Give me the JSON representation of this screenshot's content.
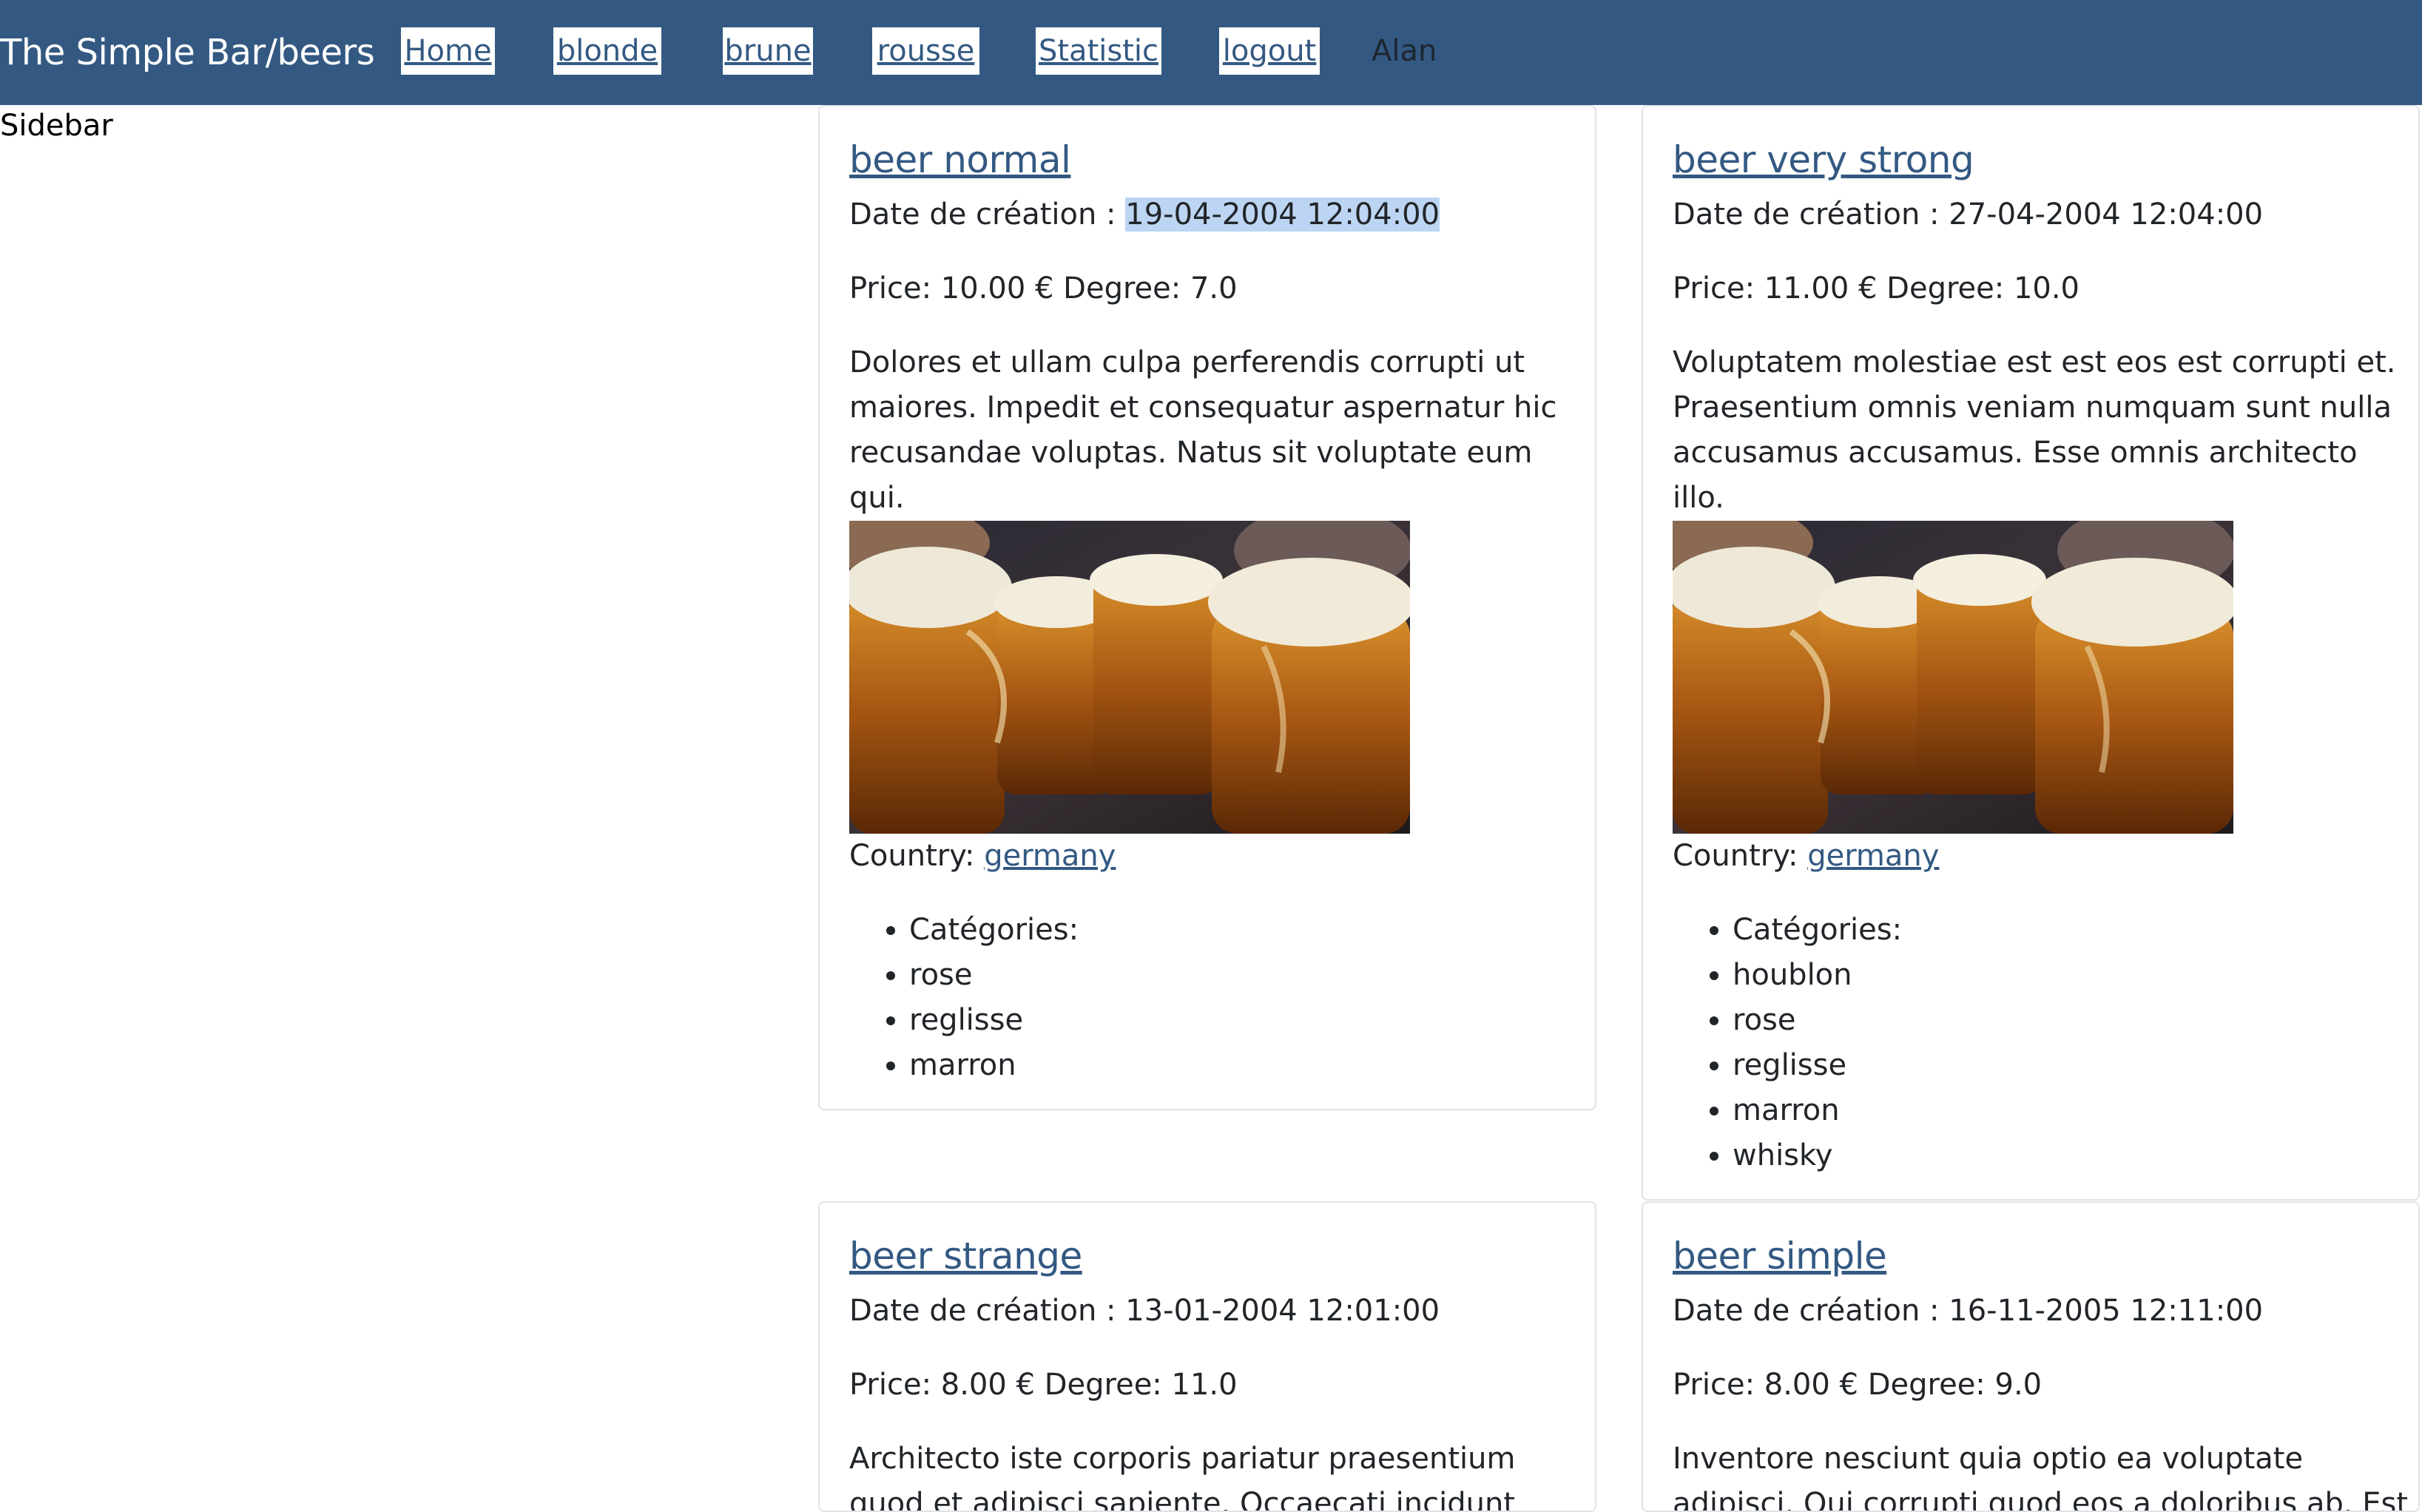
{
  "header": {
    "brand": "The Simple Bar/beers",
    "nav": {
      "home": "Home",
      "blonde": "blonde",
      "brune": "brune",
      "rousse": "rousse",
      "statistic": "Statistic",
      "logout": "logout"
    },
    "username": "Alan"
  },
  "sidebar": {
    "label": "Sidebar"
  },
  "labels": {
    "date_prefix": "Date de création : ",
    "country_prefix": "Country: ",
    "categories_heading": "Catégories:"
  },
  "beers": [
    {
      "name": "beer normal",
      "date": "19-04-2004 12:04:00",
      "price_degree": "Price: 10.00 € Degree: 7.0",
      "description": "Dolores et ullam culpa perferendis corrupti ut maiores. Impedit et consequatur aspernatur hic recusandae voluptas. Natus sit voluptate eum qui.",
      "country": "germany",
      "categories": [
        "rose",
        "reglisse",
        "marron"
      ]
    },
    {
      "name": "beer very strong",
      "date": "27-04-2004 12:04:00",
      "price_degree": "Price: 11.00 € Degree: 10.0",
      "description": "Voluptatem molestiae est est eos est corrupti et. Praesentium omnis veniam numquam sunt nulla accusamus accusamus. Esse omnis architecto illo.",
      "country": "germany",
      "categories": [
        "houblon",
        "rose",
        "reglisse",
        "marron",
        "whisky"
      ]
    },
    {
      "name": "beer strange",
      "date": "13-01-2004 12:01:00",
      "price_degree": "Price: 8.00 € Degree: 11.0",
      "description": "Architecto iste corporis pariatur praesentium quod et adipisci sapiente. Occaecati incidunt rerum est"
    },
    {
      "name": "beer simple",
      "date": "16-11-2005 12:11:00",
      "price_degree": "Price: 8.00 € Degree: 9.0",
      "description": "Inventore nesciunt quia optio ea voluptate adipisci. Qui corrupti quod eos a doloribus ab. Est ut"
    }
  ],
  "colors": {
    "header_bg": "#335982",
    "link": "#335982",
    "selection": "#bcd5f2",
    "card_border": "#dfe3e8"
  }
}
